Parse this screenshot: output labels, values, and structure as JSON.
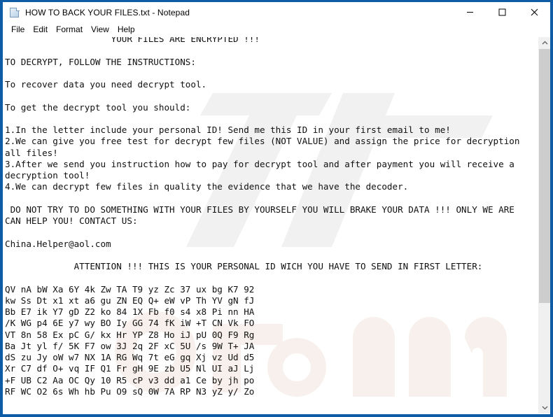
{
  "window": {
    "title": "HOW TO BACK YOUR FILES.txt - Notepad",
    "icon": "notepad-document-icon",
    "border_color": "#0e5ba6",
    "background_color": "#ffffff"
  },
  "titlebar_buttons": {
    "minimize": "minimize-icon",
    "maximize": "maximize-icon",
    "close": "close-icon"
  },
  "menubar": {
    "items": [
      {
        "label": "File"
      },
      {
        "label": "Edit"
      },
      {
        "label": "Format"
      },
      {
        "label": "View"
      },
      {
        "label": "Help"
      }
    ]
  },
  "document": {
    "contact_email": "China.Helper@aol.com",
    "lines": [
      "                    YOUR FILES ARE ENCRYPTED !!!",
      "",
      "TO DECRYPT, FOLLOW THE INSTRUCTIONS:",
      "",
      "To recover data you need decrypt tool.",
      "",
      "To get the decrypt tool you should:",
      "",
      "1.In the letter include your personal ID! Send me this ID in your first email to me!",
      "2.We can give you free test for decrypt few files (NOT VALUE) and assign the price for decryption",
      "all files!",
      "3.After we send you instruction how to pay for decrypt tool and after payment you will receive a",
      "decryption tool!",
      "4.We can decrypt few files in quality the evidence that we have the decoder.",
      "",
      " DO NOT TRY TO DO SOMETHING WITH YOUR FILES BY YOURSELF YOU WILL BRAKE YOUR DATA !!! ONLY WE ARE",
      "CAN HELP YOU! CONTACT US:",
      "",
      "China.Helper@aol.com",
      "",
      "             ATTENTION !!! THIS IS YOUR PERSONAL ID WICH YOU HAVE TO SEND IN FIRST LETTER:",
      "",
      "QV nA bW Xa 6Y 4k Zw TA T9 yz Zc 37 ux bg K7 92",
      "kw Ss Dt x1 xt a6 gu ZN EQ Q+ eW vP Th YV gN fJ",
      "Bb E7 ik Y7 gD Z2 ko 84 1X Fb f0 s4 x8 Pi nn HA",
      "/K WG p4 6E y7 wy BO Iy GG 74 fK iW +T CN Vk FO",
      "VT 8n 58 Ex pC G/ kx Hr YP Z8 Ho iJ pU 0Q F9 Rg",
      "Ba Jt yl f/ 5K F7 ow 3J 2q 2F xC 5U /s 9W T+ JA",
      "dS zu Jy oW w7 NX 1A RG Wq 7t eG gq Xj vz Ud d5",
      "Xr C7 df O+ vq IF Q1 Fr gH 9E zb U5 Nl UI aJ Lj",
      "+F UB C2 Aa OC Qy 10 R5 cP v3 dd a1 Ce by jh po",
      "RF WC O2 6s Wh hb Pu O9 sQ 0W 7A RP N3 yZ y/ Zo"
    ]
  },
  "scrollbar": {
    "up_arrow": "chevron-up-icon",
    "down_arrow": "chevron-down-icon",
    "thumb_position_percent": 0,
    "thumb_size_percent": 72
  },
  "watermark": {
    "text": ".com",
    "color": "#f0f0f0",
    "tint_color": "#f5eeea"
  }
}
